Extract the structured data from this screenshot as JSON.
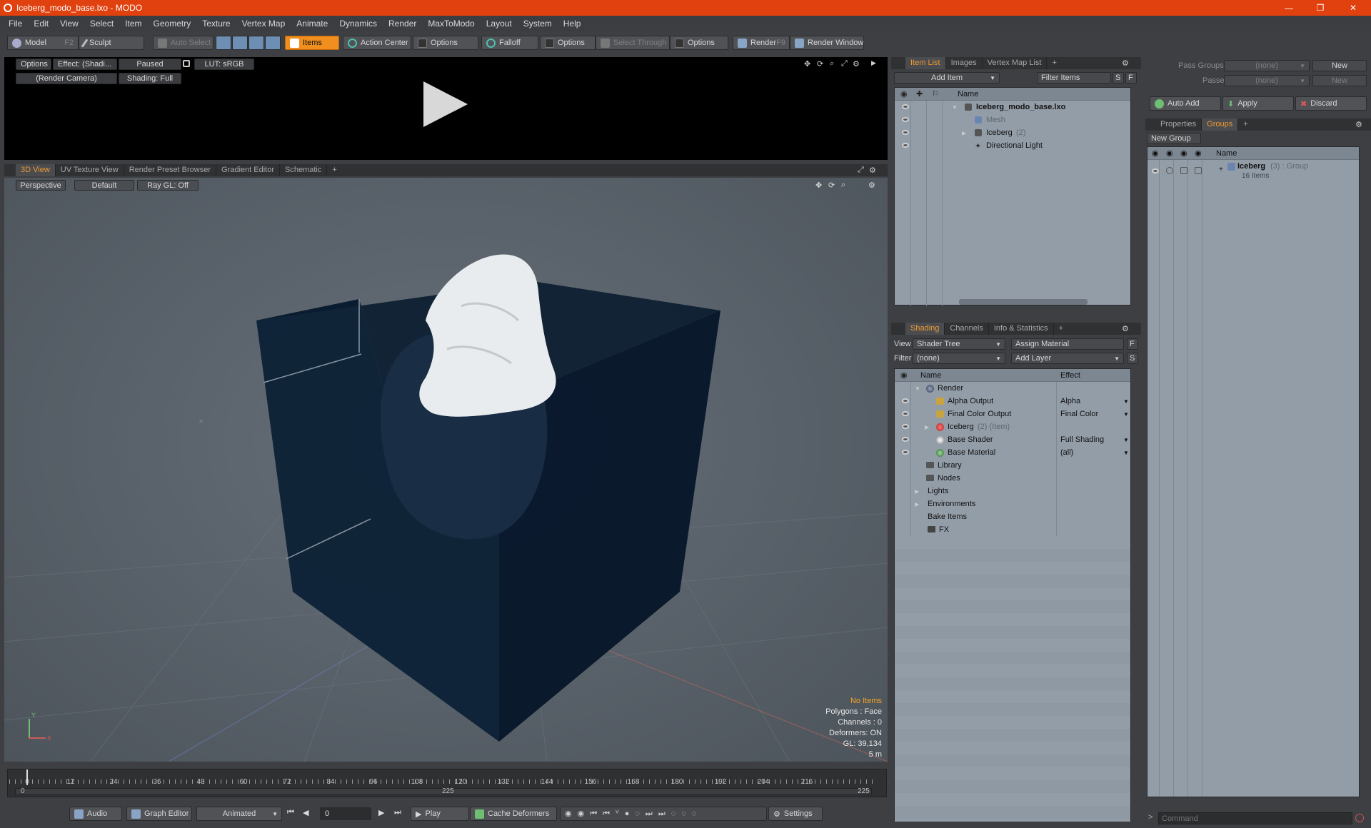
{
  "window": {
    "title": "Iceberg_modo_base.lxo - MODO",
    "min": "—",
    "max": "❐",
    "close": "✕"
  },
  "menu": [
    "File",
    "Edit",
    "View",
    "Select",
    "Item",
    "Geometry",
    "Texture",
    "Vertex Map",
    "Animate",
    "Dynamics",
    "Render",
    "MaxToModo",
    "Layout",
    "System",
    "Help"
  ],
  "toolbar": {
    "model": "Model",
    "model_key": "F2",
    "sculpt": "Sculpt",
    "auto_select": "Auto Select",
    "items": "Items",
    "action_center": "Action Center",
    "options1": "Options",
    "falloff": "Falloff",
    "options2": "Options",
    "select_through": "Select Through",
    "options3": "Options",
    "render": "Render",
    "render_key": "F9",
    "render_window": "Render Window"
  },
  "preview": {
    "options": "Options",
    "effect": "Effect: (Shadi...",
    "paused": "Paused",
    "lut": "LUT: sRGB",
    "camera": "(Render Camera)",
    "shading": "Shading: Full"
  },
  "viewtabs": [
    "3D View",
    "UV Texture View",
    "Render Preset Browser",
    "Gradient Editor",
    "Schematic",
    "+"
  ],
  "viewport": {
    "perspective": "Perspective",
    "default": "Default",
    "raygl": "Ray GL: Off",
    "stats": {
      "no_items": "No Items",
      "polygons": "Polygons : Face",
      "channels": "Channels : 0",
      "deformers": "Deformers: ON",
      "gl": "GL: 39,134",
      "scale": "5 m"
    },
    "axis_y": "Y",
    "axis_x": "X"
  },
  "timeline": {
    "ticks": [
      "0",
      "12",
      "24",
      "36",
      "48",
      "60",
      "72",
      "84",
      "96",
      "108",
      "120",
      "132",
      "144",
      "156",
      "168",
      "180",
      "192",
      "204",
      "216"
    ],
    "range_start": "0",
    "range_mid": "225",
    "range_end": "225"
  },
  "bottombar": {
    "audio": "Audio",
    "graph_editor": "Graph Editor",
    "animated": "Animated",
    "frame": "0",
    "play": "Play",
    "cache": "Cache Deformers",
    "settings": "Settings"
  },
  "itemlist": {
    "tabs": [
      "Item List",
      "Images",
      "Vertex Map List",
      "+"
    ],
    "add_item": "Add Item",
    "filter_items": "Filter Items",
    "s": "S",
    "f": "F",
    "name_header": "Name",
    "rows": [
      {
        "label": "Iceberg_modo_base.lxo",
        "extra": ""
      },
      {
        "label": "Mesh",
        "extra": ""
      },
      {
        "label": "Iceberg",
        "extra": "(2)"
      },
      {
        "label": "Directional Light",
        "extra": ""
      }
    ]
  },
  "shading": {
    "tabs": [
      "Shading",
      "Channels",
      "Info & Statistics",
      "+"
    ],
    "view_label": "View",
    "view_value": "Shader Tree",
    "assign_material": "Assign Material",
    "f": "F",
    "filter_label": "Filter",
    "filter_value": "(none)",
    "add_layer": "Add Layer",
    "s": "S",
    "name_header": "Name",
    "effect_header": "Effect",
    "rows": [
      {
        "label": "Render",
        "effect": "",
        "extra": ""
      },
      {
        "label": "Alpha Output",
        "effect": "Alpha",
        "extra": ""
      },
      {
        "label": "Final Color Output",
        "effect": "Final Color",
        "extra": ""
      },
      {
        "label": "Iceberg",
        "effect": "",
        "extra": "(2) (Item)"
      },
      {
        "label": "Base Shader",
        "effect": "Full Shading",
        "extra": ""
      },
      {
        "label": "Base Material",
        "effect": "(all)",
        "extra": ""
      },
      {
        "label": "Library",
        "effect": "",
        "extra": ""
      },
      {
        "label": "Nodes",
        "effect": "",
        "extra": ""
      },
      {
        "label": "Lights",
        "effect": "",
        "extra": ""
      },
      {
        "label": "Environments",
        "effect": "",
        "extra": ""
      },
      {
        "label": "Bake Items",
        "effect": "",
        "extra": ""
      },
      {
        "label": "FX",
        "effect": "",
        "extra": ""
      }
    ]
  },
  "passes": {
    "pass_groups": "Pass Groups",
    "passes": "Passes",
    "none1": "(none)",
    "none2": "(none)",
    "new1": "New",
    "new2": "New"
  },
  "groups": {
    "auto_add": "Auto Add",
    "apply": "Apply",
    "discard": "Discard",
    "tabs": [
      "Properties",
      "Groups",
      "+"
    ],
    "new_group": "New Group",
    "name_header": "Name",
    "group_name": "Iceberg",
    "group_meta": "(3) : Group",
    "group_items": "16 Items"
  },
  "command": {
    "placeholder": "Command"
  },
  "colors": {
    "titlebar": "#e0410e",
    "accent": "#f08e1e",
    "viewport_bg": "#586069"
  }
}
